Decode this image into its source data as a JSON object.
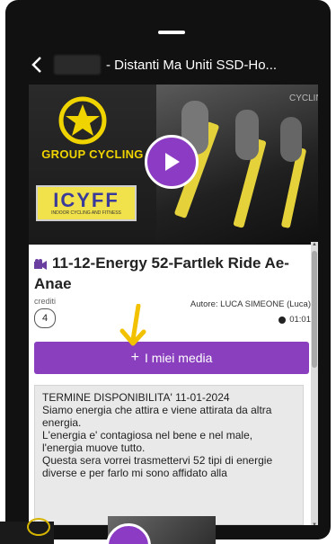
{
  "appbar": {
    "title": "- Distanti Ma Uniti SSD-Ho..."
  },
  "hero": {
    "brand": "GROUP CYCLING",
    "logo_text": "ICYFF",
    "logo_subtext": "INDOOR CYCLING AND FITNESS",
    "watermark": "CYCLIN"
  },
  "video": {
    "title": "11-12-Energy 52-Fartlek Ride Ae-Anae",
    "credits_label": "crediti",
    "credits": "4",
    "author": "Autore: LUCA SIMEONE (Luca)",
    "duration": "01:01"
  },
  "media_button": {
    "label": "I miei media"
  },
  "description": {
    "lines": [
      "TERMINE DISPONIBILITA' 11-01-2024",
      "Siamo energia che attira e viene attirata da altra energia.",
      "L'energia e' contagiosa nel bene e nel male, l'energia muove tutto.",
      "Questa sera vorrei trasmettervi 52 tipi di energie diverse e per farlo mi sono affidato alla"
    ]
  },
  "colors": {
    "accent": "#8a3fbf",
    "brand_yellow": "#f0d400",
    "annotation_arrow": "#f2c200"
  }
}
